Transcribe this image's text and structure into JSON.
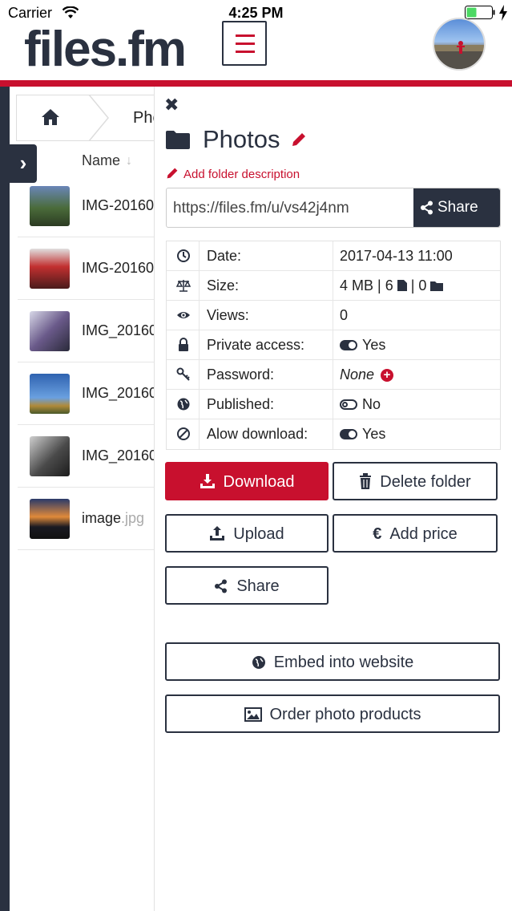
{
  "status_bar": {
    "carrier": "Carrier",
    "time": "4:25 PM"
  },
  "header": {
    "logo": "files.fm"
  },
  "breadcrumb": {
    "current": "Photos"
  },
  "file_list": {
    "column_name": "Name",
    "files": [
      {
        "name": "IMG-20160",
        "ext": "",
        "thumb_color": "#4a6b3a"
      },
      {
        "name": "IMG-20160",
        "ext": "",
        "thumb_color": "#8a2a2a"
      },
      {
        "name": "IMG_20160",
        "ext": "",
        "thumb_color": "#6a6a8a"
      },
      {
        "name": "IMG_20160",
        "ext": "",
        "thumb_color": "#3a6aa8"
      },
      {
        "name": "IMG_20160",
        "ext": "",
        "thumb_color": "#555555"
      },
      {
        "name": "image",
        "ext": ".jpg",
        "thumb_color": "#c8763a"
      }
    ]
  },
  "panel": {
    "title": "Photos",
    "add_description": "Add folder description",
    "url": "https://files.fm/u/vs42j4nm",
    "share_label": "Share",
    "info": {
      "date_label": "Date:",
      "date_value": "2017-04-13 11:00",
      "size_label": "Size:",
      "size_value": "4 MB | 6",
      "size_sep": "| 0",
      "views_label": "Views:",
      "views_value": "0",
      "private_label": "Private access:",
      "private_value": "Yes",
      "password_label": "Password:",
      "password_value": "None",
      "published_label": "Published:",
      "published_value": "No",
      "download_label": "Alow download:",
      "download_value": "Yes"
    },
    "buttons": {
      "download": "Download",
      "delete": "Delete folder",
      "upload": "Upload",
      "add_price": "Add price",
      "share": "Share",
      "embed": "Embed into website",
      "order": "Order photo products"
    }
  },
  "colors": {
    "accent": "#c8102e",
    "dark": "#2a3140"
  }
}
